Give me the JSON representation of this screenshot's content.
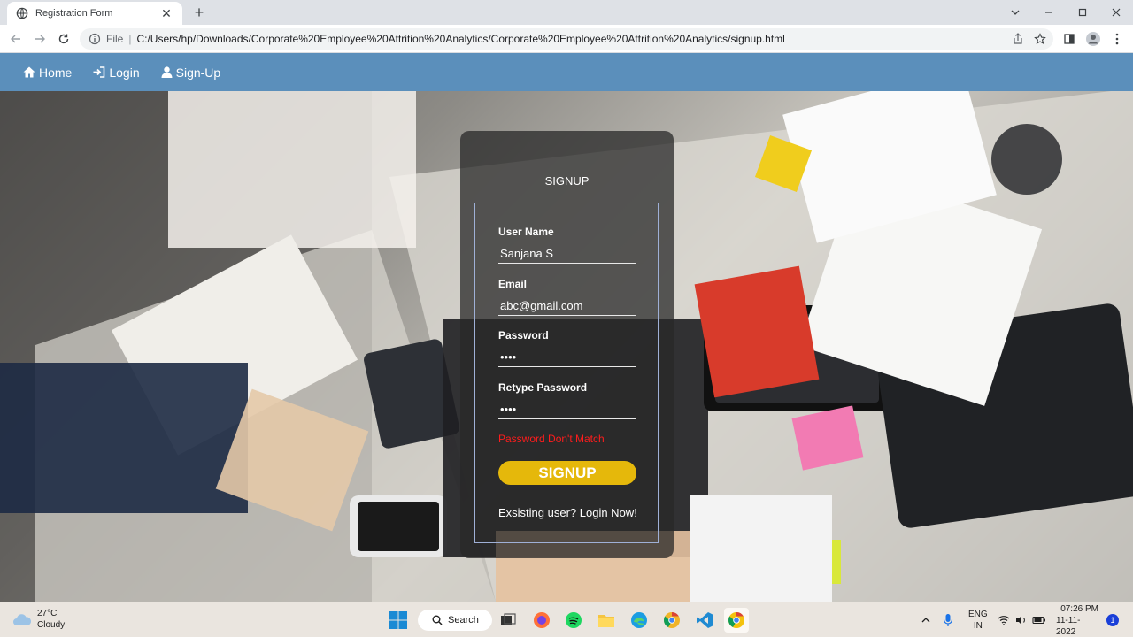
{
  "browser": {
    "tab_title": "Registration Form",
    "tab_close": "✕",
    "new_tab": "+",
    "omnibox": {
      "scheme": "File",
      "separator": "|",
      "url": "C:/Users/hp/Downloads/Corporate%20Employee%20Attrition%20Analytics/Corporate%20Employee%20Attrition%20Analytics/signup.html"
    }
  },
  "navbar": {
    "items": [
      {
        "label": "Home",
        "icon": "home-icon"
      },
      {
        "label": "Login",
        "icon": "login-icon"
      },
      {
        "label": "Sign-Up",
        "icon": "user-icon"
      }
    ]
  },
  "form": {
    "title": "SIGNUP",
    "fields": [
      {
        "label": "User Name",
        "value": "Sanjana S"
      },
      {
        "label": "Email",
        "value": "abc@gmail.com"
      },
      {
        "label": "Password",
        "value": "••••"
      },
      {
        "label": "Retype Password",
        "value": "••••"
      }
    ],
    "error": "Password Don't Match",
    "submit_label": "SIGNUP",
    "login_prompt": "Exsisting user? Login Now!"
  },
  "taskbar": {
    "weather": {
      "temp": "27°C",
      "condition": "Cloudy"
    },
    "search_label": "Search",
    "tray": {
      "language": "ENG",
      "region": "IN",
      "time": "07:26 PM",
      "date": "11-11-2022",
      "notifications": "1"
    }
  },
  "colors": {
    "navbar": "#5b8fbb",
    "card": "rgba(40,40,40,0.75)",
    "button": "#e5b80b",
    "error": "#ff1c1c"
  }
}
